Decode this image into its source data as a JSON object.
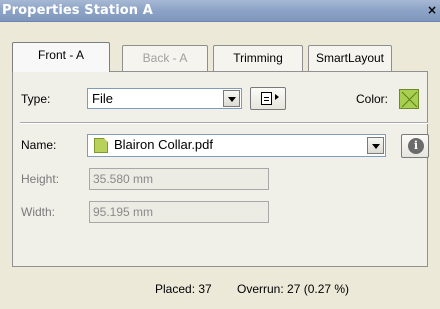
{
  "window": {
    "title": "Properties Station A",
    "close_glyph": "×"
  },
  "tabs": [
    {
      "label": "Front - A",
      "active": true,
      "enabled": true
    },
    {
      "label": "Back - A",
      "active": false,
      "enabled": false
    },
    {
      "label": "Trimming",
      "active": false,
      "enabled": true
    },
    {
      "label": "SmartLayout",
      "active": false,
      "enabled": true
    }
  ],
  "type_row": {
    "label": "Type:",
    "value": "File",
    "color_label": "Color:",
    "color_hex": "#a8cf4f",
    "doc_button_icon": "document-menu-icon"
  },
  "name_row": {
    "label": "Name:",
    "value": "Blairon Collar.pdf",
    "file_icon": "pdf-file-icon",
    "info_icon": "info-icon"
  },
  "height_row": {
    "label": "Height:",
    "value": "35.580 mm"
  },
  "width_row": {
    "label": "Width:",
    "value": "95.195 mm"
  },
  "status": {
    "placed": "Placed: 37",
    "overrun": "Overrun: 27 (0.27 %)"
  }
}
